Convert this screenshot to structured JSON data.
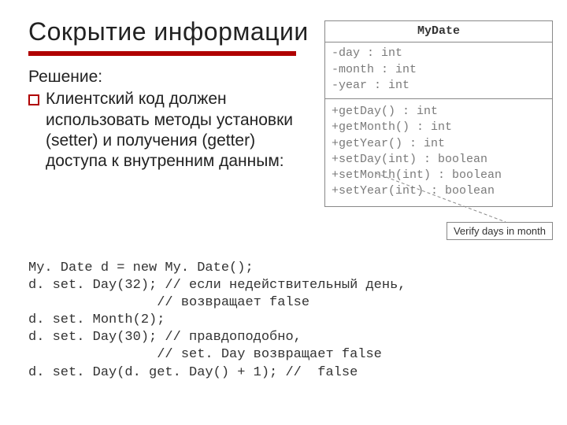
{
  "title": "Сокрытие информации",
  "solution_label": "Решение:",
  "bullet": "Клиентский код должен использовать методы установки (setter) и получения (getter) доступа к внутренним данным:",
  "uml": {
    "class_name": "MyDate",
    "fields": [
      "-day : int",
      "-month : int",
      "-year : int"
    ],
    "methods": [
      "+getDay() : int",
      "+getMonth() : int",
      "+getYear() : int",
      "+setDay(int) : boolean",
      "+setMonth(int) : boolean",
      "+setYear(int) : boolean"
    ]
  },
  "callout": "Verify days in month",
  "code": {
    "l1": "My. Date d = new My. Date();",
    "l2": "d. set. Day(32); // если недействительный день,",
    "l3": "                // возвращает false",
    "l4": "d. set. Month(2);",
    "l5": "d. set. Day(30); // правдоподобно,",
    "l6": "                // set. Day возвращает false",
    "l7": "d. set. Day(d. get. Day() + 1); //  false"
  }
}
